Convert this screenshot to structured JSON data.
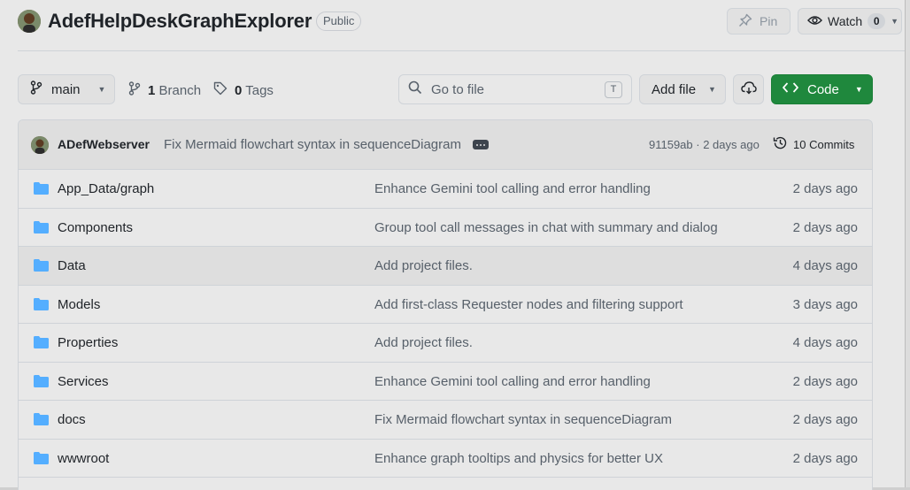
{
  "repo": {
    "name": "AdefHelpDeskGraphExplorer",
    "visibility": "Public",
    "pin_label": "Pin",
    "watch_label": "Watch",
    "watch_count": "0"
  },
  "toolbar": {
    "branch": "main",
    "branch_count": "1",
    "branch_label": "Branch",
    "tag_count": "0",
    "tag_label": "Tags",
    "search_placeholder": "Go to file",
    "search_shortcut": "T",
    "add_file_label": "Add file",
    "code_label": "Code"
  },
  "latest_commit": {
    "author": "ADefWebserver",
    "message": "Fix Mermaid flowchart syntax in sequenceDiagram",
    "hash_time": "91159ab · 2 days ago",
    "commits_label": "10 Commits"
  },
  "files": [
    {
      "name": "App_Data/graph",
      "message": "Enhance Gemini tool calling and error handling",
      "date": "2 days ago"
    },
    {
      "name": "Components",
      "message": "Group tool call messages in chat with summary and dialog",
      "date": "2 days ago"
    },
    {
      "name": "Data",
      "message": "Add project files.",
      "date": "4 days ago"
    },
    {
      "name": "Models",
      "message": "Add first-class Requester nodes and filtering support",
      "date": "3 days ago"
    },
    {
      "name": "Properties",
      "message": "Add project files.",
      "date": "4 days ago"
    },
    {
      "name": "Services",
      "message": "Enhance Gemini tool calling and error handling",
      "date": "2 days ago"
    },
    {
      "name": "docs",
      "message": "Fix Mermaid flowchart syntax in sequenceDiagram",
      "date": "2 days ago"
    },
    {
      "name": "wwwroot",
      "message": "Enhance graph tooltips and physics for better UX",
      "date": "2 days ago"
    }
  ],
  "colors": {
    "accent_green": "#1f883d",
    "folder_blue": "#54aeff",
    "text_primary": "#1f2328",
    "text_muted": "#57606a"
  },
  "icons": [
    "owner-avatar",
    "pin-icon",
    "eye-icon",
    "branch-icon",
    "tag-icon",
    "search-icon",
    "cloud-sync-icon",
    "code-icon",
    "history-icon",
    "folder-icon"
  ]
}
